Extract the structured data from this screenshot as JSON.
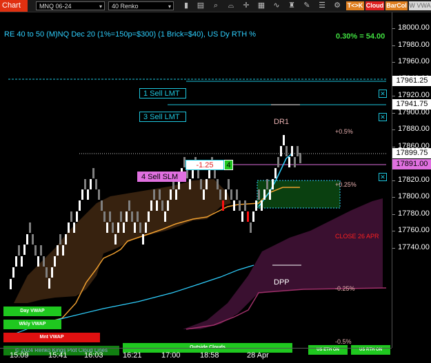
{
  "toolbar": {
    "title": "Chart",
    "instrument": "MNQ 06-24",
    "bar_type": "40 Renko",
    "btn_tk": "T<>K",
    "btn_cloud": "Cloud",
    "btn_barcol": "BarCol",
    "btn_vvwap": "W VWA"
  },
  "chart": {
    "title": "RE 40 to 50 (M)NQ Dec 20 (1%=150p=$300) (1 Brick=$40), US Dy RTH %",
    "pct_readout": "0.30% = 54.00",
    "orders": {
      "sell_lmt_1": "1 Sell LMT",
      "sell_lmt_3": "3 Sell LMT",
      "sell_slm_4": "4 Sell SLM",
      "pnl": "-1.25",
      "pnl_qty": "4"
    },
    "labels": {
      "dr1": "DR1",
      "dpp": "DPP",
      "p05": "+0.5%",
      "p025": "+0.25%",
      "m025": "-0.25%",
      "m05": "-0.5%",
      "close": "CLOSE 26 APR",
      "day_vwap": "Day VWAP",
      "wkly_vwap": "Wkly VWAP",
      "mnt_vwap": "Mnt VWAP",
      "copyright": "© 2024 Renko Kings Plot Cloud Lines",
      "outside_clouds": "Outside Clouds",
      "us_eth_on": "US ETH ON",
      "us_rth_on": "US RTH ON"
    }
  },
  "price_axis": {
    "ticks": [
      "18000.00",
      "17980.00",
      "17960.00",
      "17940.00",
      "17920.00",
      "17900.00",
      "17880.00",
      "17860.00",
      "17840.00",
      "17820.00",
      "17800.00",
      "17780.00",
      "17760.00",
      "17740.00"
    ],
    "badges": {
      "sell_lmt_1": "17961.25",
      "sell_lmt_3": "17941.75",
      "last": "17899.75",
      "sell_slm_4": "17891.00"
    }
  },
  "time_axis": {
    "ticks": [
      "15:09",
      "15:41",
      "16:03",
      "16:21",
      "17:00",
      "18:58",
      "28 Apr"
    ]
  },
  "colors": {
    "cyan": "#2fd0ff",
    "order_line": "#1ec8e0",
    "slm_line": "#e070e0",
    "vwap_orange": "#f0a030",
    "bull_brick": "#ffffff",
    "bear_brick": "#808080",
    "red_brick": "#ff1010",
    "cloud_purple": "#3a1030",
    "cloud_brown": "#3a2410",
    "green_label": "#1fc81f"
  }
}
